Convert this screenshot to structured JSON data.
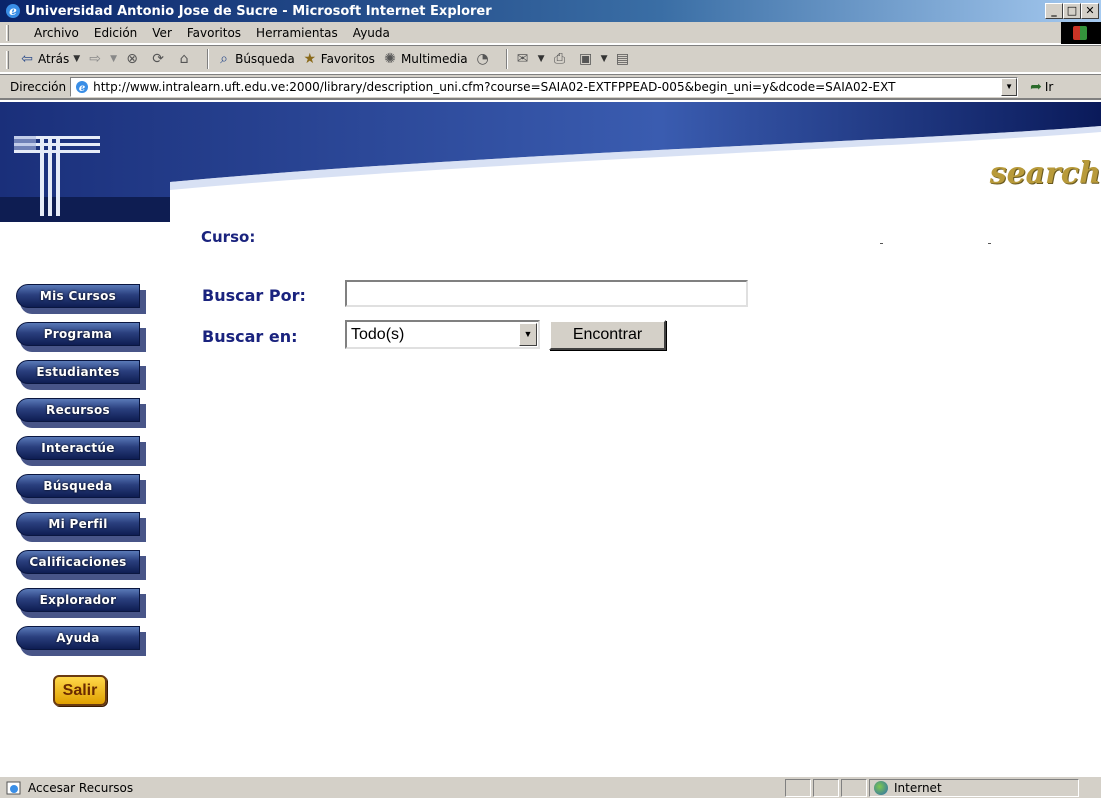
{
  "window": {
    "title": "Universidad Antonio Jose de Sucre - Microsoft Internet Explorer",
    "minimize": "_",
    "maximize": "□",
    "close": "✕"
  },
  "menu": {
    "items": [
      "Archivo",
      "Edición",
      "Ver",
      "Favoritos",
      "Herramientas",
      "Ayuda"
    ]
  },
  "toolbar": {
    "back_label": "Atrás",
    "search_label": "Búsqueda",
    "favorites_label": "Favoritos",
    "multimedia_label": "Multimedia"
  },
  "address": {
    "label": "Dirección",
    "url": "http://www.intralearn.uft.edu.ve:2000/library/description_uni.cfm?course=SAIA02-EXTFPPEAD-005&begin_uni=y&dcode=SAIA02-EXT",
    "go_label": "Ir"
  },
  "page": {
    "search_logo_text": "search",
    "curso_label": "Curso:",
    "nav": [
      "Mis Cursos",
      "Programa",
      "Estudiantes",
      "Recursos",
      "Interactúe",
      "Búsqueda",
      "Mi Perfil",
      "Calificaciones",
      "Explorador",
      "Ayuda"
    ],
    "salir_label": "Salir",
    "form": {
      "buscar_por_label": "Buscar Por:",
      "buscar_por_value": "",
      "buscar_en_label": "Buscar en:",
      "buscar_en_selected": "Todo(s)",
      "find_button": "Encontrar"
    }
  },
  "status": {
    "text": "Accesar Recursos",
    "zone": "Internet"
  },
  "colors": {
    "nav_blue": "#1a237e",
    "label_blue": "#1a237e",
    "salir_gold": "#e0a000"
  }
}
